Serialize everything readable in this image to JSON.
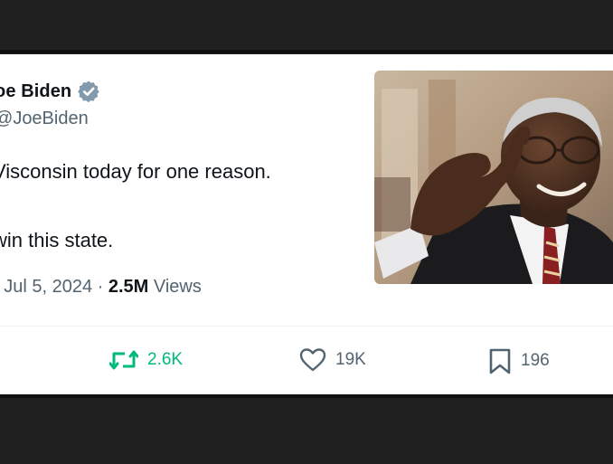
{
  "tweet": {
    "author_name": "oe Biden",
    "handle": "JoeBiden",
    "text_lines": [
      "Visconsin today for one reason.",
      "",
      "win this state."
    ],
    "meta": {
      "prefix": "· Jul 5, 2024 · ",
      "views_count": "2.5M",
      "views_label": " Views"
    },
    "actions": {
      "retweets": "2.6K",
      "likes": "19K",
      "bookmarks": "196"
    }
  },
  "colors": {
    "verified_badge": "#829aab",
    "retweet_active": "#00ba7c",
    "secondary_text": "#536471",
    "primary_text": "#0f1419",
    "background": "#ffffff",
    "frame": "#202020"
  },
  "icons": {
    "verified": "verified-badge-icon",
    "retweet": "retweet-icon",
    "like": "heart-icon",
    "bookmark": "bookmark-icon"
  }
}
